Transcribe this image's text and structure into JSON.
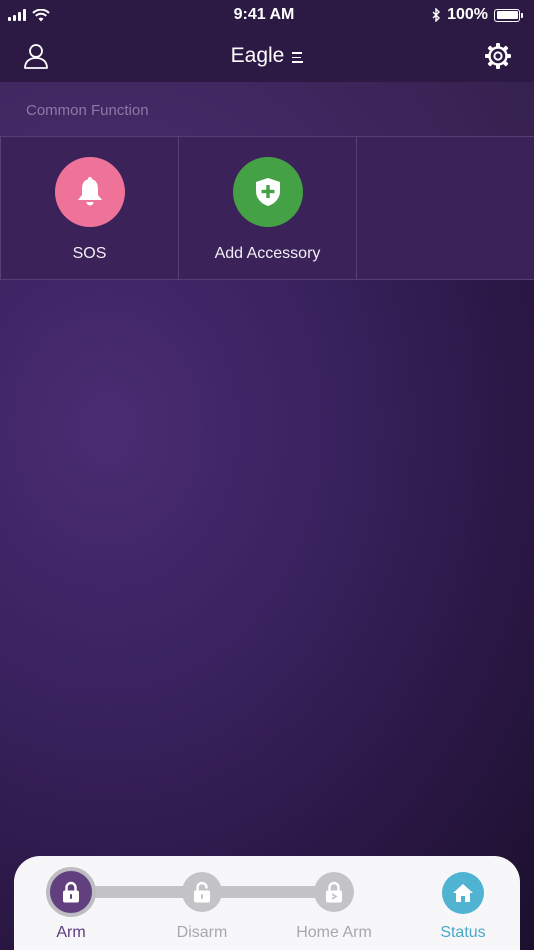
{
  "status_bar": {
    "time": "9:41 AM",
    "battery": "100%"
  },
  "nav": {
    "title": "Eagle",
    "icons": {
      "left": "user-icon",
      "title_menu": "menu-icon",
      "right": "gear-icon"
    }
  },
  "section": {
    "title": "Common Function"
  },
  "functions": [
    {
      "label": "SOS",
      "icon": "bell-icon",
      "color": "#ef7399"
    },
    {
      "label": "Add Accessory",
      "icon": "shield-plus-icon",
      "color": "#45a145"
    }
  ],
  "modes": {
    "arm": {
      "label": "Arm",
      "icon": "lock-icon",
      "active": true
    },
    "disarm": {
      "label": "Disarm",
      "icon": "unlock-icon"
    },
    "home_arm": {
      "label": "Home Arm",
      "icon": "home-lock-icon"
    },
    "status": {
      "label": "Status",
      "icon": "home-icon",
      "color": "#4fb3d1"
    }
  },
  "colors": {
    "accent": "#62407f",
    "background": "#3a2360",
    "status_blue": "#4fb3d1"
  }
}
